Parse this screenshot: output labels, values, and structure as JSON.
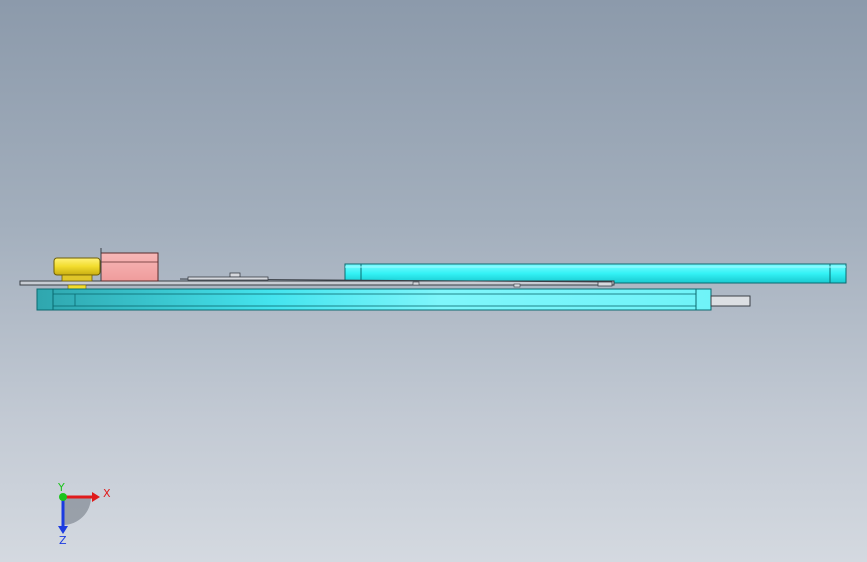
{
  "viewport": {
    "background_top": "#8c9aab",
    "background_bottom": "#d4d9e0"
  },
  "colors": {
    "cyan_part": "#33f2f5",
    "cyan_edge": "#0a6a70",
    "pink_part": "#f4a3a3",
    "yellow_part": "#f2dc2c",
    "grey_part": "#dcdfe3",
    "board_line": "#3a3f46"
  },
  "triad": {
    "x_label": "X",
    "y_label": "Y",
    "z_label": "Z",
    "x_color": "#e01b1b",
    "y_color": "#1bc41b",
    "z_color": "#1b3be0"
  }
}
